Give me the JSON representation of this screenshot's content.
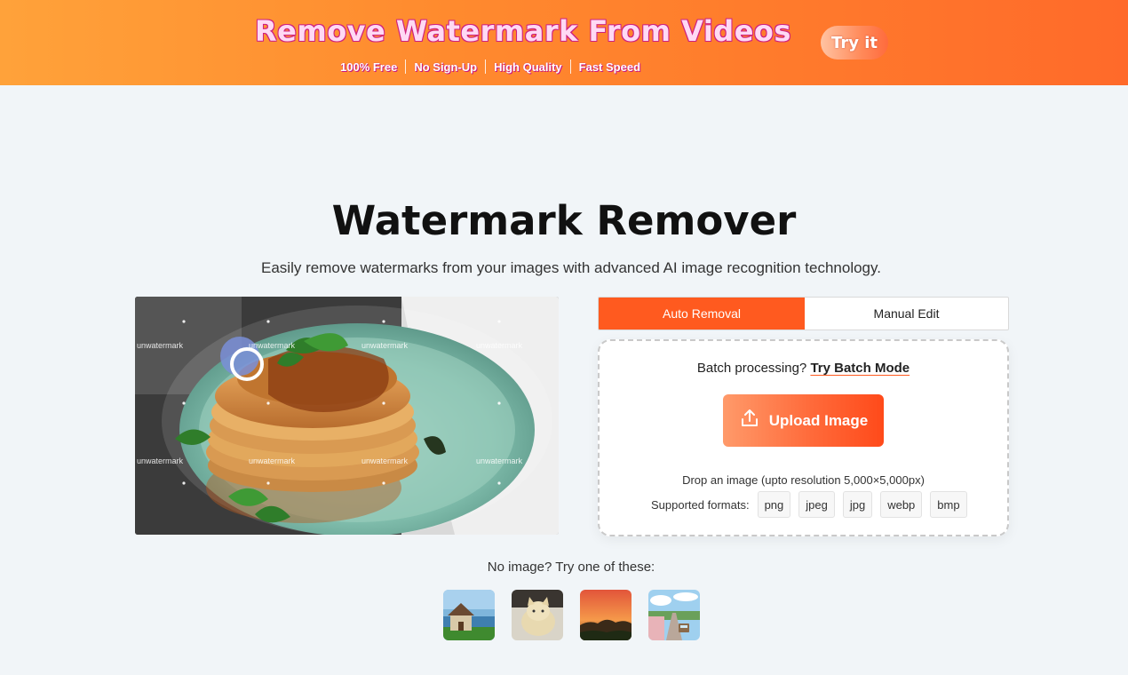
{
  "banner": {
    "title": "Remove Watermark From Videos",
    "features": [
      "100% Free",
      "No Sign-Up",
      "High Quality",
      "Fast Speed"
    ],
    "try_label": "Try it"
  },
  "main": {
    "title": "Watermark Remover",
    "subtitle": "Easily remove watermarks from your images with advanced AI image recognition technology."
  },
  "preview": {
    "watermark_text": "unwatermark"
  },
  "tabs": [
    {
      "label": "Auto Removal",
      "active": true
    },
    {
      "label": "Manual Edit",
      "active": false
    }
  ],
  "upload": {
    "batch_prefix": "Batch processing?",
    "batch_link": "Try Batch Mode",
    "button_label": "Upload Image",
    "drop_hint": "Drop an image (upto resolution 5,000×5,000px)",
    "formats_label": "Supported formats:",
    "formats": [
      "png",
      "jpeg",
      "jpg",
      "webp",
      "bmp"
    ]
  },
  "samples": {
    "label": "No image? Try one of these:",
    "items": [
      {
        "name": "house"
      },
      {
        "name": "cat"
      },
      {
        "name": "sunset"
      },
      {
        "name": "road"
      }
    ]
  },
  "colors": {
    "accent": "#ff5a1f",
    "banner_start": "#ffa23a",
    "banner_end": "#ff6a2a",
    "background": "#f1f5f8"
  }
}
